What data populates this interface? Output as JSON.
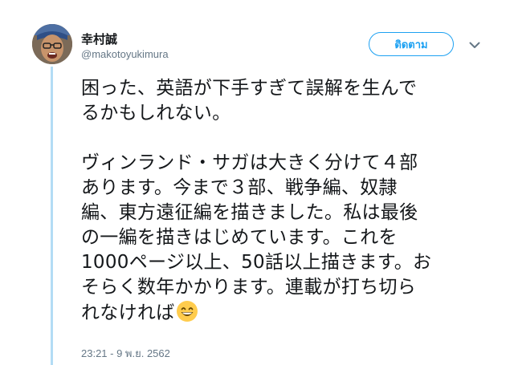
{
  "colors": {
    "accent": "#1da1f2",
    "text": "#14171a",
    "muted": "#657786",
    "thread_line": "#b3dcf5",
    "emoji": "#ffcc4d"
  },
  "author": {
    "display_name": "幸村誠",
    "handle": "@makotoyukimura",
    "avatar_icon": "user-avatar"
  },
  "follow_button": {
    "label": "ติดตาม"
  },
  "more_menu": {
    "icon": "chevron-down-icon"
  },
  "tweet": {
    "lines": [
      "困った、英語が下手すぎて誤解を生んで",
      "るかもしれない。",
      "",
      "ヴィンランド・サガは大きく分けて４部",
      "あります。今まで３部、戦争編、奴隷",
      "編、東方遠征編を描きました。私は最後",
      "の一編を描きはじめています。これを",
      "1000ページ以上、50話以上描きます。お",
      "そらく数年かかります。連載が打ち切ら",
      "れなければ"
    ],
    "emoji": "grinning-face-with-smiling-eyes",
    "timestamp": "23:21 - 9 พ.ย. 2562"
  }
}
